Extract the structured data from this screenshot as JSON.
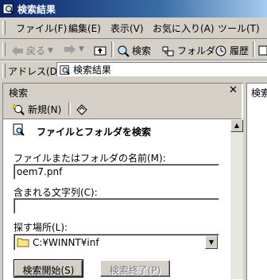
{
  "window": {
    "title": "検索結果"
  },
  "menu": [
    {
      "label": "ファイル(F)"
    },
    {
      "label": "編集(E)"
    },
    {
      "label": "表示(V)"
    },
    {
      "label": "お気に入り(A)"
    },
    {
      "label": "ツール(T)"
    }
  ],
  "toolbar": {
    "back_label": "戻る",
    "search_label": "検索",
    "folders_label": "フォルダ",
    "history_label": "履歴"
  },
  "address": {
    "label": "アドレス(D)",
    "value": "検索結果"
  },
  "search_pane": {
    "title": "検索",
    "new_label": "新規(N)",
    "heading": "ファイルとフォルダを検索",
    "name_label": "ファイルまたはフォルダの名前(M):",
    "name_value": "oem7.pnf",
    "contains_label": "含まれる文字列(C):",
    "contains_value": "",
    "look_in_label": "探す場所(L):",
    "look_in_value": "C:¥WINNT¥inf",
    "search_now": "検索開始(S)",
    "stop_search": "検索終了(P)"
  },
  "results_pane": {
    "title": "検索"
  }
}
